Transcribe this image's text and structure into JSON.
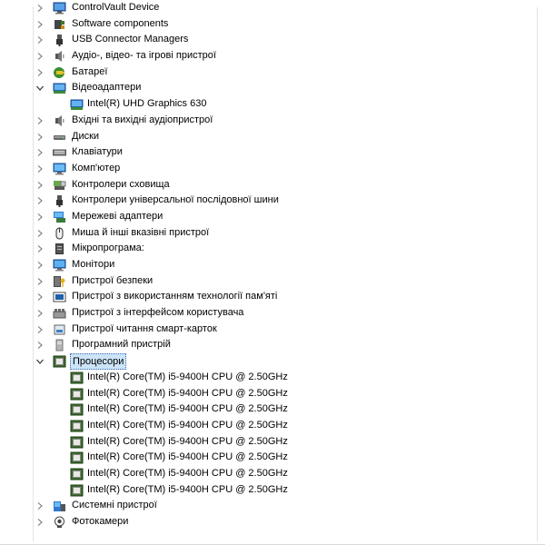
{
  "devices": [
    {
      "label": "ControlVault Device",
      "level": 0,
      "expanded": false,
      "icon": "controlvault-icon"
    },
    {
      "label": "Software components",
      "level": 0,
      "expanded": false,
      "icon": "software-components-icon"
    },
    {
      "label": "USB Connector Managers",
      "level": 0,
      "expanded": false,
      "icon": "usb-icon"
    },
    {
      "label": "Аудіо-, відео- та ігрові пристрої",
      "level": 0,
      "expanded": false,
      "icon": "speaker-icon"
    },
    {
      "label": "Батареї",
      "level": 0,
      "expanded": false,
      "icon": "battery-icon"
    },
    {
      "label": "Відеоадаптери",
      "level": 0,
      "expanded": true,
      "icon": "display-adapter-icon"
    },
    {
      "label": "Intel(R) UHD Graphics 630",
      "level": 1,
      "icon": "display-adapter-icon"
    },
    {
      "label": "Вхідні та вихідні аудіопристрої",
      "level": 0,
      "expanded": false,
      "icon": "speaker-icon"
    },
    {
      "label": "Диски",
      "level": 0,
      "expanded": false,
      "icon": "disk-icon"
    },
    {
      "label": "Клавіатури",
      "level": 0,
      "expanded": false,
      "icon": "keyboard-icon"
    },
    {
      "label": "Комп'ютер",
      "level": 0,
      "expanded": false,
      "icon": "computer-icon"
    },
    {
      "label": "Контролери сховища",
      "level": 0,
      "expanded": false,
      "icon": "storage-controller-icon"
    },
    {
      "label": "Контролери універсальної послідовної шини",
      "level": 0,
      "expanded": false,
      "icon": "usb-icon"
    },
    {
      "label": "Мережеві адаптери",
      "level": 0,
      "expanded": false,
      "icon": "network-adapter-icon"
    },
    {
      "label": "Миша й інші вказівні пристрої",
      "level": 0,
      "expanded": false,
      "icon": "mouse-icon"
    },
    {
      "label": "Мікропрограма:",
      "level": 0,
      "expanded": false,
      "icon": "firmware-icon"
    },
    {
      "label": "Монітори",
      "level": 0,
      "expanded": false,
      "icon": "monitor-icon"
    },
    {
      "label": "Пристрої безпеки",
      "level": 0,
      "expanded": false,
      "icon": "security-device-icon"
    },
    {
      "label": "Пристрої з використанням технології пам'яті",
      "level": 0,
      "expanded": false,
      "icon": "memory-device-icon"
    },
    {
      "label": "Пристрої з інтерфейсом користувача",
      "level": 0,
      "expanded": false,
      "icon": "hid-icon"
    },
    {
      "label": "Пристрої читання смарт-карток",
      "level": 0,
      "expanded": false,
      "icon": "smart-card-reader-icon"
    },
    {
      "label": "Програмний пристрій",
      "level": 0,
      "expanded": false,
      "icon": "software-device-icon"
    },
    {
      "label": "Процесори",
      "level": 0,
      "expanded": true,
      "selected": true,
      "icon": "processor-icon"
    },
    {
      "label": "Intel(R) Core(TM) i5-9400H CPU @ 2.50GHz",
      "level": 1,
      "icon": "processor-icon"
    },
    {
      "label": "Intel(R) Core(TM) i5-9400H CPU @ 2.50GHz",
      "level": 1,
      "icon": "processor-icon"
    },
    {
      "label": "Intel(R) Core(TM) i5-9400H CPU @ 2.50GHz",
      "level": 1,
      "icon": "processor-icon"
    },
    {
      "label": "Intel(R) Core(TM) i5-9400H CPU @ 2.50GHz",
      "level": 1,
      "icon": "processor-icon"
    },
    {
      "label": "Intel(R) Core(TM) i5-9400H CPU @ 2.50GHz",
      "level": 1,
      "icon": "processor-icon"
    },
    {
      "label": "Intel(R) Core(TM) i5-9400H CPU @ 2.50GHz",
      "level": 1,
      "icon": "processor-icon"
    },
    {
      "label": "Intel(R) Core(TM) i5-9400H CPU @ 2.50GHz",
      "level": 1,
      "icon": "processor-icon"
    },
    {
      "label": "Intel(R) Core(TM) i5-9400H CPU @ 2.50GHz",
      "level": 1,
      "icon": "processor-icon"
    },
    {
      "label": "Системні пристрої",
      "level": 0,
      "expanded": false,
      "icon": "system-device-icon"
    },
    {
      "label": "Фотокамери",
      "level": 0,
      "expanded": false,
      "icon": "camera-icon"
    }
  ],
  "colors": {
    "selection_bg": "#cce4f7",
    "selection_border": "#3e6db5",
    "chevron": "#777777"
  }
}
